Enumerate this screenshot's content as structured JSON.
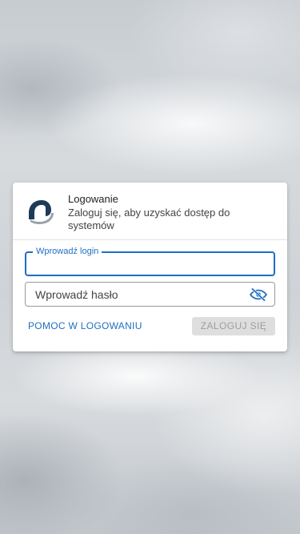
{
  "login_card": {
    "logo": {
      "icon": "brand-logo-icon",
      "colors": [
        "#1e3a5a",
        "#9aa3ab"
      ]
    },
    "title": "Logowanie",
    "subtitle": "Zaloguj się, aby uzyskać dostęp do systemów",
    "login_field": {
      "label": "Wprowadź login",
      "value": "",
      "state": "focused"
    },
    "password_field": {
      "placeholder": "Wprowadź hasło",
      "value": "",
      "toggle_icon": "eye-off-icon"
    },
    "help_link": "POMOC W LOGOWANIU",
    "submit_button": {
      "label": "ZALOGUJ SIĘ",
      "state": "disabled"
    }
  },
  "colors": {
    "accent": "#1e6fc2",
    "disabled_bg": "#dedede",
    "disabled_text": "#9e9e9e",
    "card_bg": "#ffffff"
  }
}
